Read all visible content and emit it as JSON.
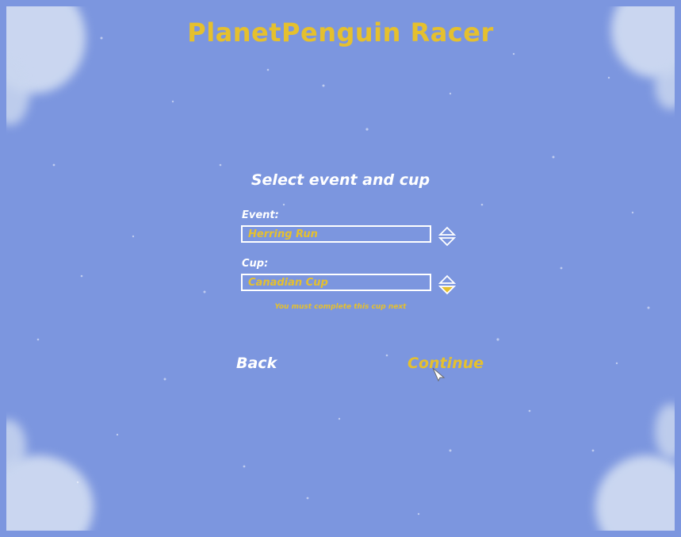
{
  "app": {
    "title": "PlanetPenguin Racer"
  },
  "screen": {
    "heading": "Select event and cup"
  },
  "event": {
    "label": "Event:",
    "value": "Herring Run"
  },
  "cup": {
    "label": "Cup:",
    "value": "Canadian Cup",
    "hint": "You must complete this cup next"
  },
  "nav": {
    "back_label": "Back",
    "continue_label": "Continue"
  },
  "colors": {
    "background": "#7c96df",
    "accent": "#e5c02e",
    "text": "#ffffff"
  },
  "icons": {
    "selector": "up-down-arrows-icon",
    "cursor": "mouse-pointer-icon"
  }
}
